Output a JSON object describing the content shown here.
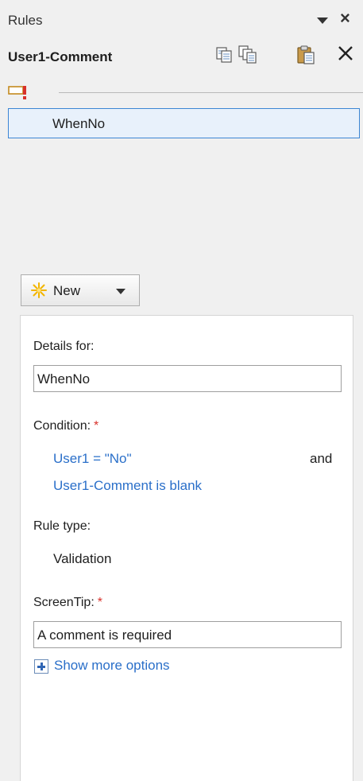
{
  "pane": {
    "title": "Rules",
    "field_name": "User1-Comment"
  },
  "rules": [
    {
      "label": "WhenNo"
    }
  ],
  "new_button": {
    "label": "New"
  },
  "details": {
    "details_for_label": "Details for:",
    "rule_name": "WhenNo",
    "condition_label": "Condition:",
    "required_mark": "*",
    "conditions": [
      "User1 = \"No\"",
      "User1-Comment is blank"
    ],
    "conjunction": "and",
    "rule_type_label": "Rule type:",
    "rule_type": "Validation",
    "screentip_label": "ScreenTip:",
    "screentip_value": "A comment is required",
    "show_more": "Show more options"
  },
  "icons": {
    "title_menu": "dropdown-caret-icon",
    "title_close": "close-icon",
    "copy": "copy-rule-icon",
    "copy_all": "copy-all-rules-icon",
    "paste": "paste-rule-icon",
    "delete": "delete-icon",
    "validation_marker": "validation-rule-icon",
    "new": "new-sparkle-icon",
    "expand": "plus-icon"
  }
}
